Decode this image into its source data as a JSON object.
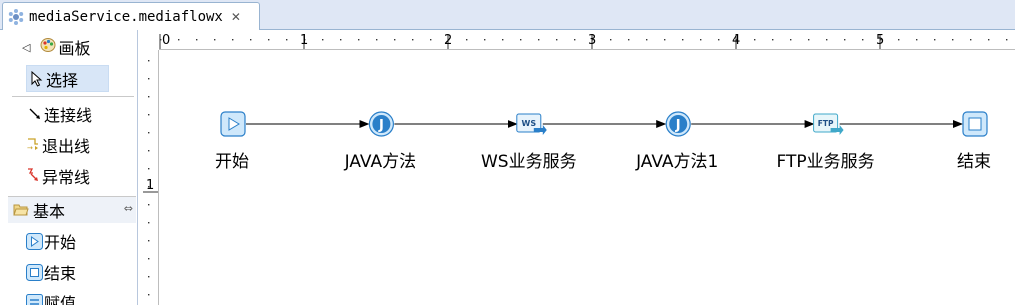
{
  "editor": {
    "tab_title": "mediaService.mediaflowx",
    "tab_close": "✕"
  },
  "palette": {
    "header_label": "画板",
    "collapse_arrow": "◁",
    "tools": [
      {
        "label": "选择",
        "icon": "arrow-cursor-icon",
        "selected": true
      },
      {
        "label": "连接线",
        "icon": "connection-line-icon"
      },
      {
        "label": "退出线",
        "icon": "exit-line-icon"
      },
      {
        "label": "异常线",
        "icon": "exception-line-icon"
      }
    ],
    "group": {
      "label": "基本",
      "icon": "folder-open-icon",
      "pin": "⇔",
      "items": [
        {
          "label": "开始",
          "icon": "start-node-icon"
        },
        {
          "label": "结束",
          "icon": "end-node-icon"
        },
        {
          "label": "赋值",
          "icon": "assign-node-icon"
        }
      ]
    }
  },
  "ruler": {
    "top_marks": [
      "0",
      "1",
      "2",
      "3",
      "4",
      "5"
    ],
    "left_marks": [
      "1"
    ]
  },
  "flow": {
    "nodes": [
      {
        "label": "开始",
        "icon": "start-node-icon"
      },
      {
        "label": "JAVA方法",
        "icon": "java-method-icon",
        "glyph": "J"
      },
      {
        "label": "WS业务服务",
        "icon": "ws-service-icon",
        "glyph": "WS"
      },
      {
        "label": "JAVA方法1",
        "icon": "java-method-icon",
        "glyph": "J"
      },
      {
        "label": "FTP业务服务",
        "icon": "ftp-service-icon",
        "glyph": "FTP"
      },
      {
        "label": "结束",
        "icon": "end-node-icon"
      }
    ]
  },
  "colors": {
    "tab_bar": "#dfe7f5",
    "selection": "#d8e6f7",
    "node_blue": "#2a7fc9",
    "node_light": "#cfe8fb",
    "ftp_teal": "#3fa8c9"
  }
}
